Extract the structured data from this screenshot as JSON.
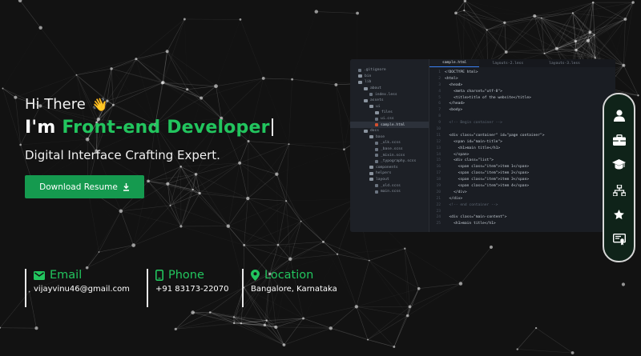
{
  "hero": {
    "greeting": "Hi There",
    "greeting_emoji": "👋",
    "title_prefix": "I'm",
    "title_role": "Front-end Developer",
    "subtitle": "Digital Interface Crafting Expert.",
    "button_label": "Download Resume"
  },
  "contacts": [
    {
      "icon": "mail-icon",
      "label": "Email",
      "value": "vijayvinu46@gmail.com"
    },
    {
      "icon": "phone-icon",
      "label": "Phone",
      "value": "+91 83173-22070"
    },
    {
      "icon": "location-pin-icon",
      "label": "Location",
      "value": "Bangalore, Karnataka"
    }
  ],
  "editor": {
    "tabs": [
      "sample.html",
      "layouts-2.less",
      "layouts-3.less"
    ],
    "tree": [
      ".gitignore",
      "bin",
      "lib",
      "about",
      "index.less",
      "assets",
      "ui",
      "files",
      "ui.css",
      "sample.html",
      "docs",
      "base",
      "_ulk.scss",
      "_base.scss",
      "_mixin.scss",
      "_typography.scss",
      "components",
      "helpers",
      "layout",
      "_old.scss",
      "main.scss"
    ],
    "lines": [
      "<!DOCTYPE html>",
      "<html>",
      "  <head>",
      "    <meta charset=\"utf-8\">",
      "    <title>title of the website</title>",
      "  </head>",
      "  <body>",
      "",
      "  <!-- Begin container -->",
      "",
      "  <div class=\"container\" id=\"page container\">",
      "    <span id=\"main-title\">",
      "      <h1>main title</h1>",
      "    </span>",
      "    <div class=\"list\">",
      "      <span class=\"item\">item 1</span>",
      "      <span class=\"item\">item 2</span>",
      "      <span class=\"item\">item 3</span>",
      "      <span class=\"item\">item 4</span>",
      "    </div>",
      "  </div>",
      "  <!-- end container -->",
      "",
      "  <div class=\"main-content\">",
      "    <h1>main title</h1>"
    ]
  },
  "dock": [
    "user-icon",
    "briefcase-icon",
    "graduation-cap-icon",
    "sitemap-icon",
    "star-icon",
    "certificate-icon"
  ],
  "colors": {
    "accent": "#22c55e",
    "button": "#159a4f",
    "background": "#121212",
    "dock_bg": "#0f2319"
  }
}
